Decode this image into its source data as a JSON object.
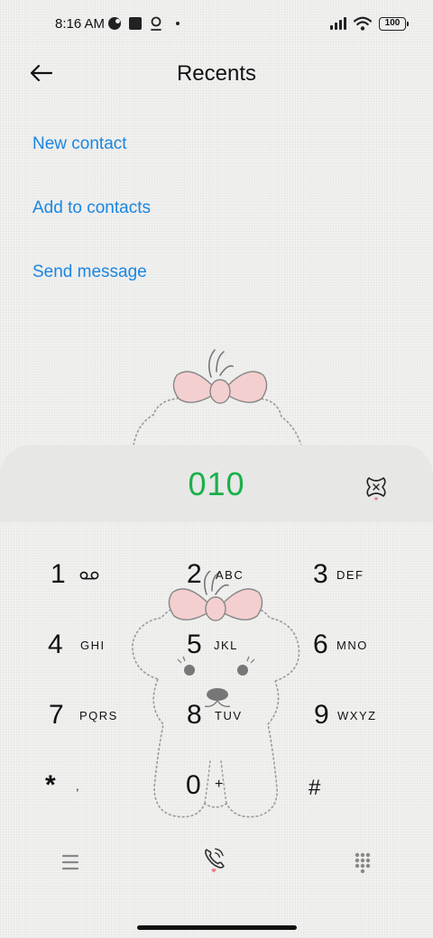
{
  "status_bar": {
    "time": "8:16 AM",
    "battery": "100",
    "left_icons": [
      "circle-app-icon",
      "square-app-icon",
      "location-pin-icon",
      "dot-icon"
    ],
    "right_icons": [
      "signal-icon",
      "wifi-icon",
      "battery-icon"
    ]
  },
  "header": {
    "title": "Recents",
    "back_icon": "arrow-left-icon"
  },
  "options": [
    {
      "label": "New contact"
    },
    {
      "label": "Add to contacts"
    },
    {
      "label": "Send message"
    }
  ],
  "dialer": {
    "number": "010",
    "delete_icon": "backspace-icon",
    "keys": [
      {
        "digit": "1",
        "letters": "",
        "icon": "voicemail-icon"
      },
      {
        "digit": "2",
        "letters": "ABC"
      },
      {
        "digit": "3",
        "letters": "DEF"
      },
      {
        "digit": "4",
        "letters": "GHI"
      },
      {
        "digit": "5",
        "letters": "JKL"
      },
      {
        "digit": "6",
        "letters": "MNO"
      },
      {
        "digit": "7",
        "letters": "PQRS"
      },
      {
        "digit": "8",
        "letters": "TUV"
      },
      {
        "digit": "9",
        "letters": "WXYZ"
      },
      {
        "digit": "*",
        "letters": ","
      },
      {
        "digit": "0",
        "letters": "+"
      },
      {
        "digit": "#",
        "letters": ""
      }
    ]
  },
  "bottom_nav": {
    "menu_icon": "menu-icon",
    "call_icon": "call-icon",
    "keypad_icon": "dialpad-icon"
  },
  "colors": {
    "accent_link": "#1a86e0",
    "number_green": "#19b04a",
    "bow_pink": "#f4cfcf",
    "heart_pink": "#f07b8a"
  }
}
